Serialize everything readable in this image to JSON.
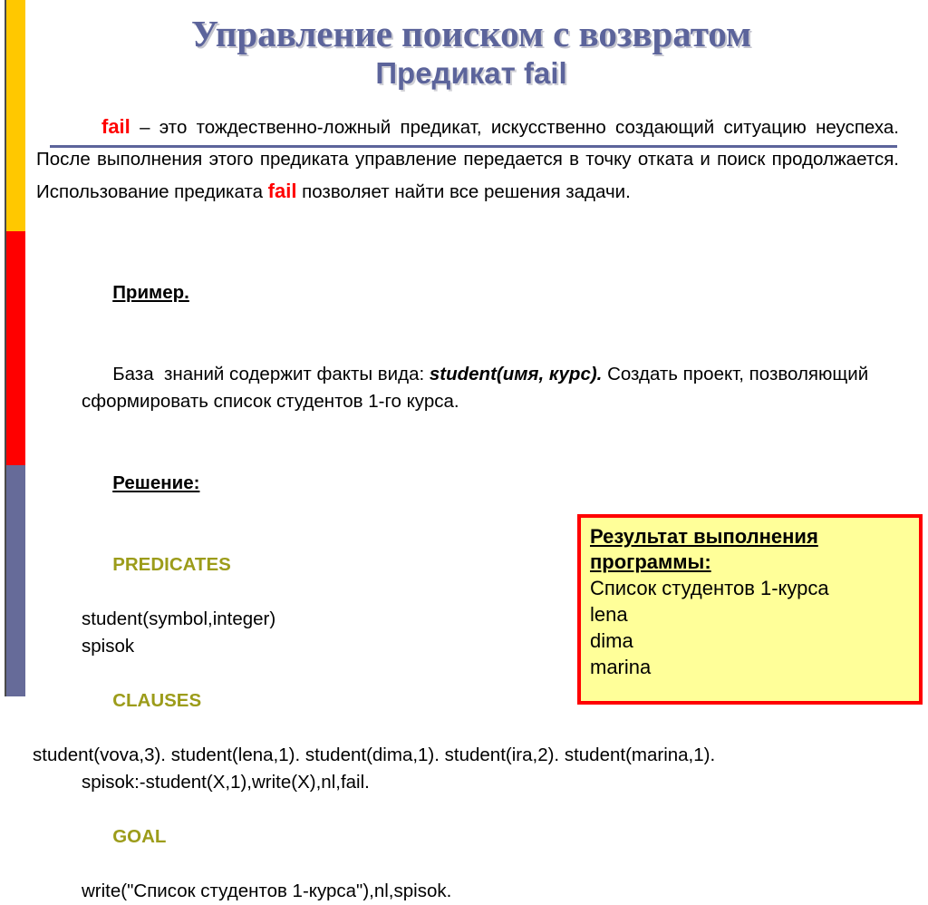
{
  "slide": {
    "title": "Управление поиском с возвратом",
    "subtitle": "Предикат fail"
  },
  "intro": {
    "keyword": "fail",
    "part1": " – это тождественно-ложный предикат, искусственно создающий ситуацию неуспеха. После выполнения этого предиката управление передается в точку отката и поиск продолжается. Использование предиката ",
    "keyword2": "fail",
    "part2": " позволяет найти все решения задачи."
  },
  "example": {
    "label": "Пример.",
    "text_before": "База  знаний содержит факты вида: ",
    "fact_form": "student(имя, курс).",
    "text_after": " Создать проект, позволяющий сформировать список студентов 1-го курса.",
    "solution_label": "Решение:"
  },
  "code": {
    "predicates_kw": "PREDICATES",
    "predicates_lines": [
      "student(symbol,integer)",
      "spisok"
    ],
    "clauses_kw": "CLAUSES",
    "clauses_lines": [
      "student(vova,3). student(lena,1). student(dima,1). student(ira,2). student(marina,1).",
      "spisok:-student(X,1),write(X),nl,fail."
    ],
    "goal_kw": "GOAL",
    "goal_lines": [
      "write(\"Список студентов 1-курса\"),nl,spisok."
    ]
  },
  "result_box": {
    "title_line1": "Результат выполнения",
    "title_line2": "программы:",
    "lines": [
      "Список студентов 1-курса",
      "lena",
      "dima",
      "marina"
    ]
  },
  "colors": {
    "bar_top": "#ffc800",
    "bar_mid": "#ff0000",
    "bar_bottom": "#666b99",
    "title": "#5c649b",
    "keyword_red": "#ff0000",
    "keyword_olive": "#9c9c1a",
    "box_fill": "#ffff99",
    "box_border": "#ff0000"
  }
}
